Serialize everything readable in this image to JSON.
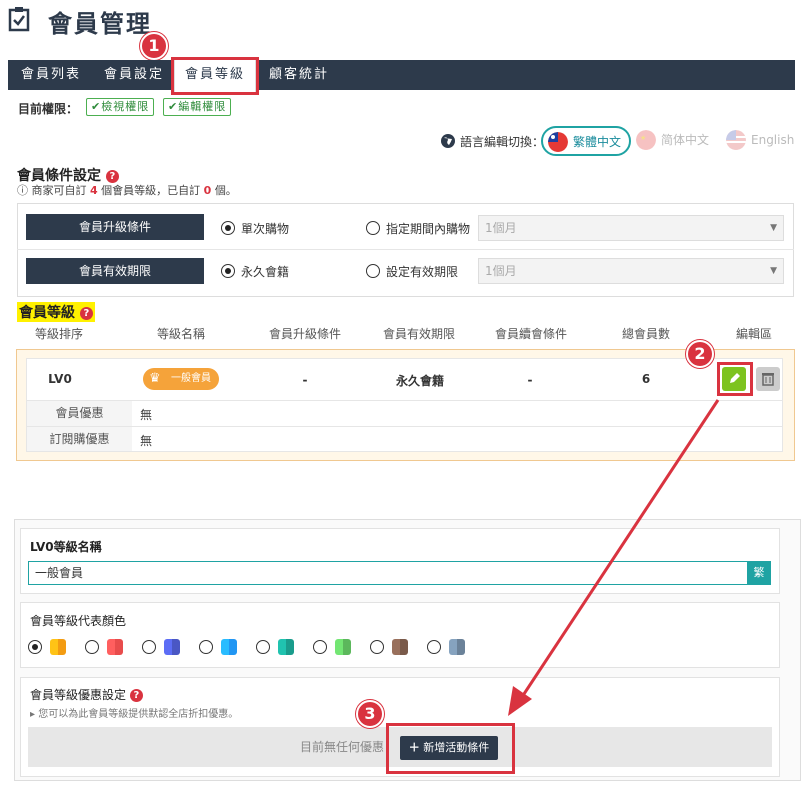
{
  "page": {
    "title": "會員管理"
  },
  "tabs": [
    {
      "label": "會員列表"
    },
    {
      "label": "會員設定"
    },
    {
      "label": "會員等級"
    },
    {
      "label": "顧客統計"
    }
  ],
  "steps": {
    "one": "1",
    "two": "2",
    "three": "3"
  },
  "permissions": {
    "label": "目前權限：",
    "view": "檢視權限",
    "edit": "編輯權限"
  },
  "language": {
    "label": "語言編輯切換：",
    "options": [
      {
        "label": "繁體中文",
        "active": true
      },
      {
        "label": "简体中文",
        "active": false
      },
      {
        "label": "English",
        "active": false
      }
    ]
  },
  "conditions": {
    "title": "會員條件設定",
    "note_prefix": "商家可自訂",
    "note_count": "4",
    "note_mid": "個會員等級，已自訂",
    "note_used": "0",
    "note_suffix": "個。",
    "upgrade": {
      "label": "會員升級條件",
      "option1": "單次購物",
      "option2": "指定期間內購物",
      "select": "1個月"
    },
    "validity": {
      "label": "會員有效期限",
      "option1": "永久會籍",
      "option2": "設定有效期限",
      "select": "1個月"
    }
  },
  "levels": {
    "title": "會員等級",
    "headers": [
      "等級排序",
      "等級名稱",
      "會員升級條件",
      "會員有效期限",
      "會員續會條件",
      "總會員數",
      "編輯區"
    ],
    "row": {
      "rank": "LV0",
      "name": "一般會員",
      "upgrade": "-",
      "validity": "永久會籍",
      "renewal": "-",
      "members": "6"
    },
    "sub": [
      {
        "label": "會員優惠",
        "value": "無"
      },
      {
        "label": "訂閱購優惠",
        "value": "無"
      }
    ]
  },
  "editor": {
    "name_label": "LV0等級名稱",
    "name_value": "一般會員",
    "lang_button": "繁",
    "color_label": "會員等級代表顏色",
    "colors": [
      "#f39c12",
      "#e84c4c",
      "#4a57c4",
      "#2196f3",
      "#1a9c8c",
      "#5cb85c",
      "#7a5a4a",
      "#6b8299"
    ],
    "discount_label": "會員等級優惠設定",
    "discount_note": "您可以為此會員等級提供默認全店折扣優惠。",
    "empty_text": "目前無任何優惠",
    "add_button": "新增活動條件"
  },
  "colors": {
    "primary": "#2d3a4b",
    "accent": "#1fa3a3",
    "highlight": "#d9333f"
  }
}
